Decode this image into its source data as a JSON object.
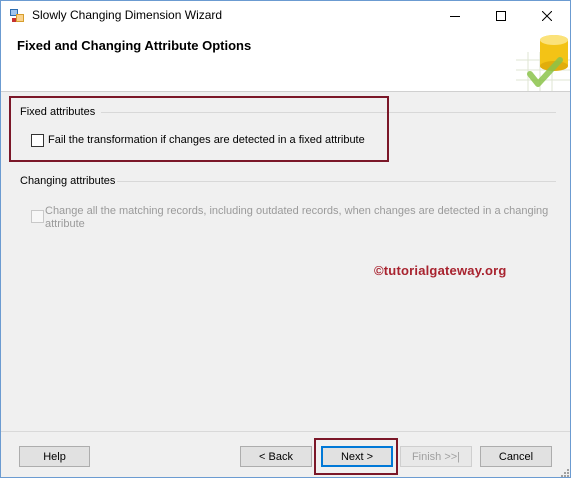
{
  "window": {
    "title": "Slowly Changing Dimension Wizard"
  },
  "header": {
    "title": "Fixed and Changing Attribute Options"
  },
  "fixed_attributes": {
    "group_label": "Fixed attributes",
    "checkbox_label": "Fail the transformation if changes are detected in a fixed attribute",
    "checked": false
  },
  "changing_attributes": {
    "group_label": "Changing attributes",
    "checkbox_label_line1": "Change all the matching records, including outdated records, when changes are detected in a changing",
    "checkbox_label_line2": "attribute",
    "checked": false,
    "enabled": false
  },
  "watermark": {
    "text": "©tutorialgateway.org"
  },
  "footer": {
    "help_label": "Help",
    "back_label": "< Back",
    "next_label": "Next >",
    "finish_label": "Finish >>|",
    "cancel_label": "Cancel"
  },
  "colors": {
    "highlight": "#7b1728",
    "watermark": "#a8232f",
    "default_button_border": "#0078d7"
  }
}
